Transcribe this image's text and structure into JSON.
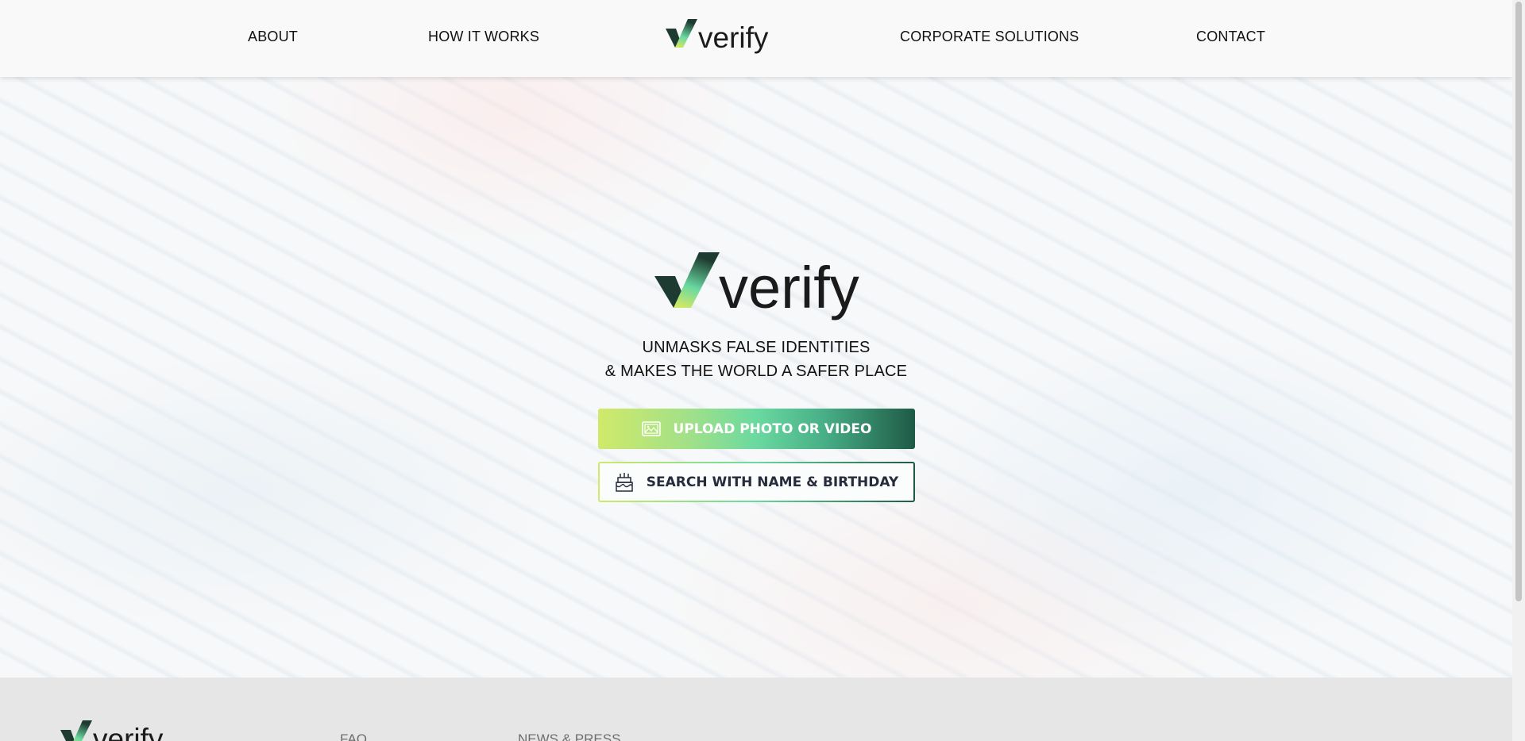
{
  "nav": {
    "links": [
      "ABOUT",
      "HOW IT WORKS",
      "CORPORATE SOLUTIONS",
      "CONTACT"
    ],
    "logo_text": "verify"
  },
  "hero": {
    "logo_text": "verify",
    "tagline_line1": "UNMASKS FALSE IDENTITIES",
    "tagline_line2": "& MAKES THE WORLD A SAFER PLACE",
    "upload_button": {
      "label": "UPLOAD PHOTO OR VIDEO",
      "icon": "image-icon"
    },
    "search_button": {
      "label": "SEARCH WITH NAME & BIRTHDAY",
      "icon": "birthday-cake-icon"
    }
  },
  "footer": {
    "logo_text": "verify",
    "links": [
      "FAQ",
      "NEWS & PRESS"
    ]
  },
  "colors": {
    "brand_dark": "#1e3b31",
    "brand_green": "#6ad9a0",
    "brand_lime": "#d0e96a",
    "footer_bg": "#e6e6e6"
  }
}
